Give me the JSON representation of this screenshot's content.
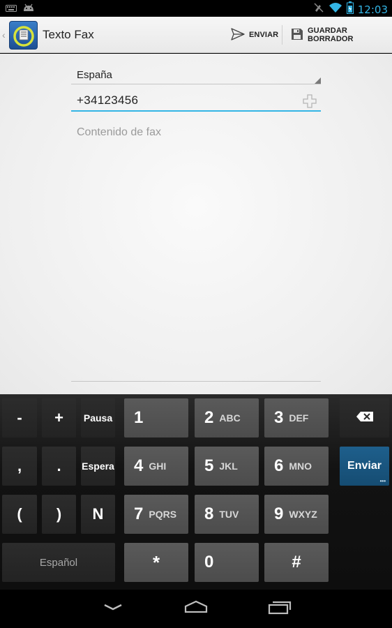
{
  "statusbar": {
    "time": "12:03",
    "icons": [
      "keyboard-icon",
      "android-icon",
      "signal-muted-icon",
      "wifi-icon",
      "battery-icon"
    ]
  },
  "actionbar": {
    "title": "Texto Fax",
    "send_label": "ENVIAR",
    "save_label": "GUARDAR BORRADOR"
  },
  "form": {
    "country": "España",
    "phone": "+34123456",
    "content_placeholder": "Contenido de fax"
  },
  "keyboard": {
    "dash": "-",
    "plus": "+",
    "pause": "Pausa",
    "comma": ",",
    "period": ".",
    "wait": "Espera",
    "lparen": "(",
    "rparen": ")",
    "n": "N",
    "language": "Español",
    "enter": "Enter",
    "enter_label": "Enviar",
    "keys": [
      {
        "digit": "1",
        "letters": ""
      },
      {
        "digit": "2",
        "letters": "ABC"
      },
      {
        "digit": "3",
        "letters": "DEF"
      },
      {
        "digit": "4",
        "letters": "GHI"
      },
      {
        "digit": "5",
        "letters": "JKL"
      },
      {
        "digit": "6",
        "letters": "MNO"
      },
      {
        "digit": "7",
        "letters": "PQRS"
      },
      {
        "digit": "8",
        "letters": "TUV"
      },
      {
        "digit": "9",
        "letters": "WXYZ"
      },
      {
        "digit": "*",
        "letters": ""
      },
      {
        "digit": "0",
        "letters": ""
      },
      {
        "digit": "#",
        "letters": ""
      }
    ]
  },
  "colors": {
    "accent": "#33b5e5",
    "enter_key": "#1e5f8c"
  }
}
